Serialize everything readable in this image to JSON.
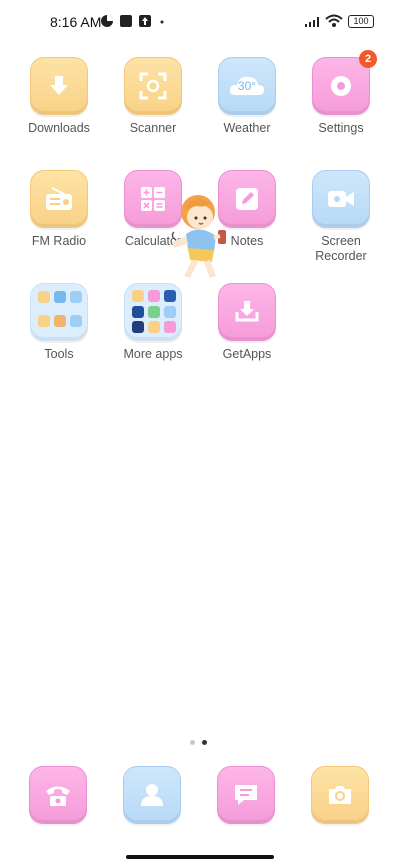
{
  "status_bar": {
    "time": "8:16 AM",
    "battery": "100"
  },
  "apps": [
    {
      "label": "Downloads",
      "icon": "download-icon",
      "color": "yellow"
    },
    {
      "label": "Scanner",
      "icon": "scanner-icon",
      "color": "yellow"
    },
    {
      "label": "Weather",
      "icon": "weather-icon",
      "color": "blue",
      "icon_text": "30°"
    },
    {
      "label": "Settings",
      "icon": "settings-icon",
      "color": "pink",
      "badge": "2"
    },
    {
      "label": "FM Radio",
      "icon": "radio-icon",
      "color": "yellow"
    },
    {
      "label": "Calculator",
      "icon": "calculator-icon",
      "color": "pink"
    },
    {
      "label": "Notes",
      "icon": "notes-icon",
      "color": "pink"
    },
    {
      "label": "Screen\nRecorder",
      "icon": "screen-recorder-icon",
      "color": "blue"
    },
    {
      "label": "Tools",
      "icon": "folder-icon",
      "color": "folder"
    },
    {
      "label": "More apps",
      "icon": "folder-icon",
      "color": "folder"
    },
    {
      "label": "GetApps",
      "icon": "getapps-icon",
      "color": "pink"
    }
  ],
  "dock": [
    {
      "icon": "phone-icon",
      "color": "pink"
    },
    {
      "icon": "contacts-icon",
      "color": "blue"
    },
    {
      "icon": "messages-icon",
      "color": "pink"
    },
    {
      "icon": "camera-icon",
      "color": "yellow"
    }
  ],
  "page_indicator": {
    "pages": 2,
    "current": 2
  }
}
